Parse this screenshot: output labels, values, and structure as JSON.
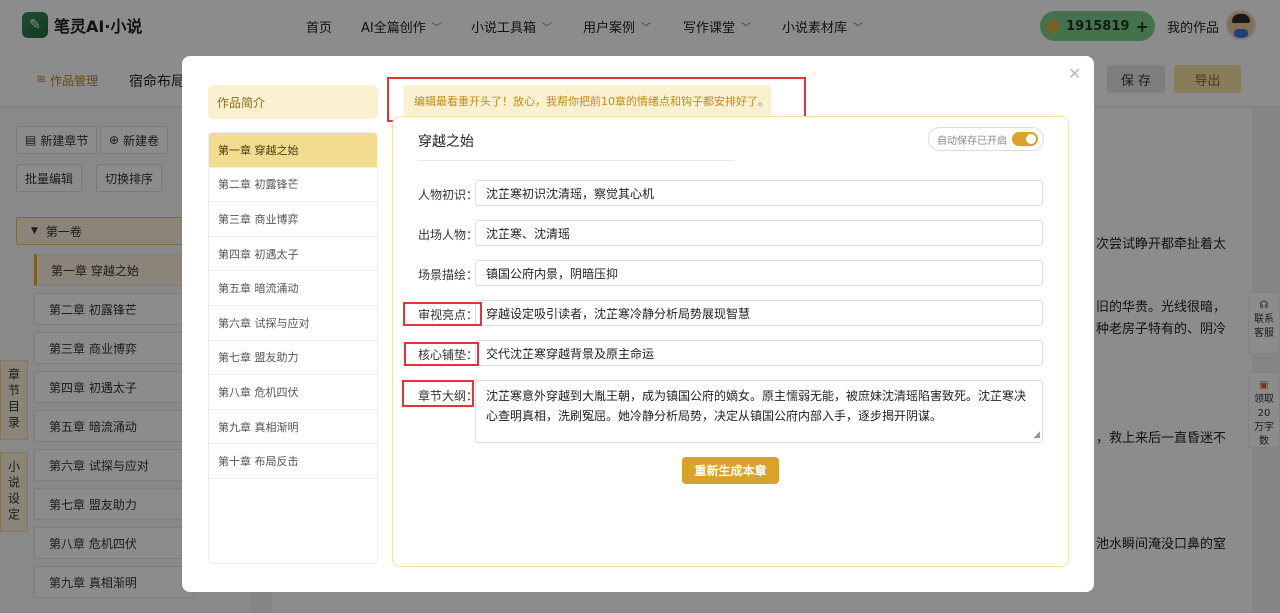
{
  "app": {
    "logo_text": "笔灵AI·小说",
    "logo_glyph": "✎"
  },
  "nav": {
    "items": [
      {
        "label": "首页",
        "dropdown": false
      },
      {
        "label": "AI全篇创作",
        "dropdown": true
      },
      {
        "label": "小说工具箱",
        "dropdown": true
      },
      {
        "label": "用户案例",
        "dropdown": true
      },
      {
        "label": "写作课堂",
        "dropdown": true
      },
      {
        "label": "小说素材库",
        "dropdown": true
      }
    ],
    "points": "1915819",
    "my_works": "我的作品"
  },
  "background": {
    "breadcrumb_label": "作品管理",
    "book_title": "宿命布局",
    "save_label": "保 存",
    "export_label": "导出",
    "new_chapter": "新建章节",
    "new_volume": "新建卷",
    "batch_edit": "批量编辑",
    "toggle_sort": "切换排序",
    "volume": "第一卷",
    "chapters": [
      "第一章 穿越之始",
      "第二章 初露锋芒",
      "第三章 商业博弈",
      "第四章 初遇太子",
      "第五章 暗流涌动",
      "第六章 试探与应对",
      "第七章 盟友助力",
      "第八章 危机四伏",
      "第九章 真相渐明"
    ],
    "side_tabs": [
      "章节目录",
      "小说设定"
    ],
    "text_lines": [
      "次尝试睁开都牵扯着太",
      "旧的华贵。光线很暗，",
      "种老房子特有的、阴冷",
      "，救上来后一直昏迷不",
      "池水瞬间淹没口鼻的窒"
    ],
    "service": "联系客服",
    "reward": "领取20万字数"
  },
  "modal": {
    "intro_tab": "作品简介",
    "chapters": [
      "第一章 穿越之始",
      "第二章 初露锋芒",
      "第三章 商业博弈",
      "第四章 初遇太子",
      "第五章 暗流涌动",
      "第六章 试探与应对",
      "第七章 盟友助力",
      "第八章 危机四伏",
      "第九章 真相渐明",
      "第十章 布局反击"
    ],
    "tip": "编辑最看重开头了！放心，我帮你把前10章的情绪点和钩子都安排好了。",
    "chapter_title": "穿越之始",
    "autosave": "自动保存已开启",
    "fields": {
      "characters_label": "人物初识：",
      "characters_value": "沈芷寒初识沈清瑶，察觉其心机",
      "appearing_label": "出场人物：",
      "appearing_value": "沈芷寒、沈清瑶",
      "scene_label": "场景描绘：",
      "scene_value": "镇国公府内景，阴暗压抑",
      "highlight_label": "审视亮点：",
      "highlight_value": "穿越设定吸引读者，沈芷寒冷静分析局势展现智慧",
      "foreshadow_label": "核心铺垫：",
      "foreshadow_value": "交代沈芷寒穿越背景及原主命运",
      "outline_label": "章节大纲：",
      "outline_value": "沈芷寒意外穿越到大胤王朝，成为镇国公府的嫡女。原主懦弱无能，被庶妹沈清瑶陷害致死。沈芷寒决心查明真相，洗刷冤屈。她冷静分析局势，决定从镇国公府内部入手，逐步揭开阴谋。"
    },
    "regenerate": "重新生成本章"
  },
  "colors": {
    "accent": "#d9a22a",
    "highlight_box": "#e0353f",
    "points_bg": "#7fd08f"
  }
}
